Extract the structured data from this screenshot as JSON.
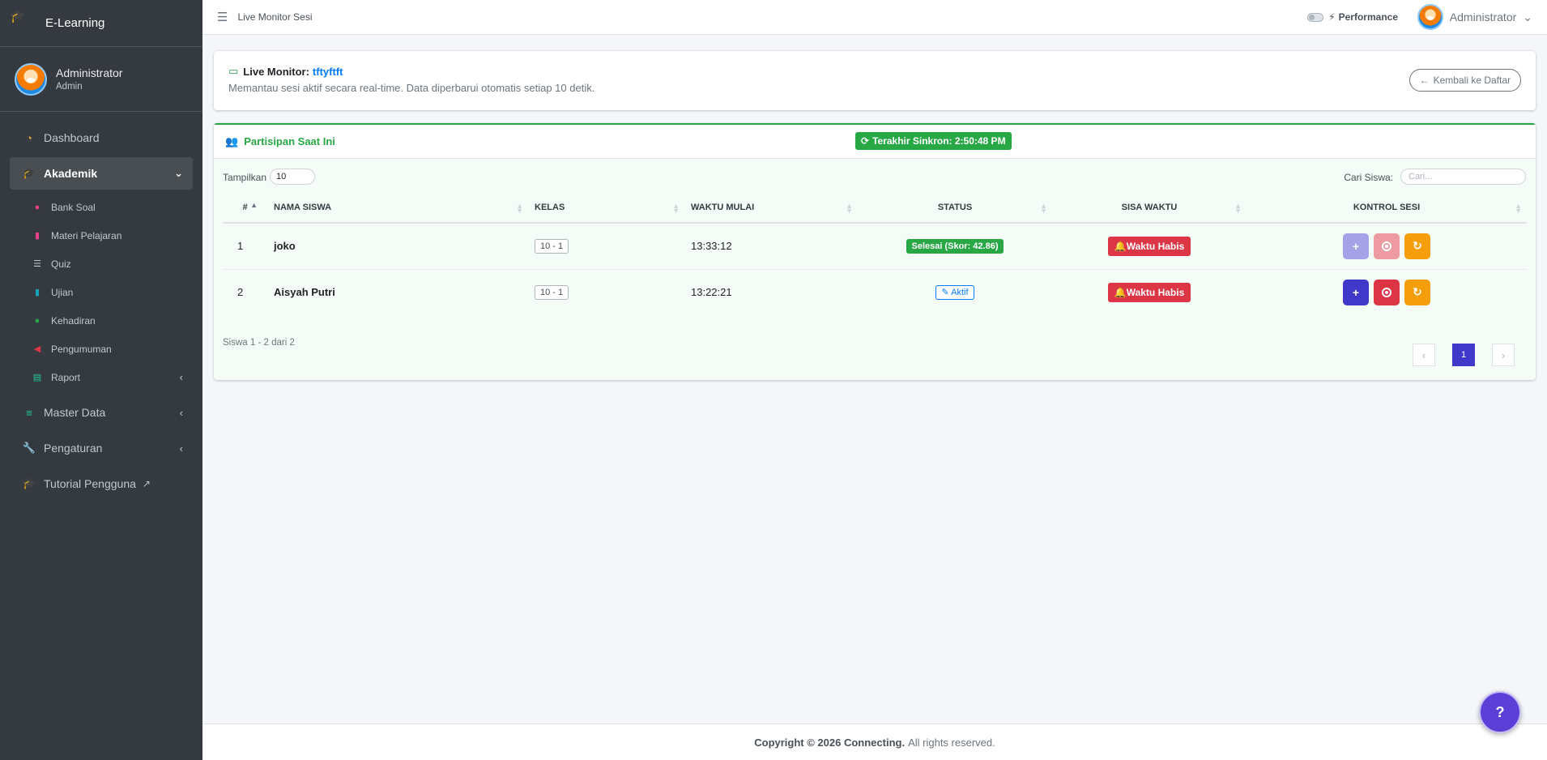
{
  "brand": {
    "name": "E-Learning",
    "logo_icon": "graduation-cap-icon"
  },
  "user": {
    "name": "Administrator",
    "role": "Admin"
  },
  "sidebar": {
    "items": [
      {
        "label": "Dashboard",
        "icon": "tachometer-icon",
        "icon_color": "#f0ad4e"
      },
      {
        "label": "Akademik",
        "icon": "graduation-cap-icon",
        "icon_color": "#17a2b8",
        "active": true
      },
      {
        "label": "Master Data",
        "icon": "database-icon",
        "icon_color": "#20c997"
      },
      {
        "label": "Pengaturan",
        "icon": "wrench-icon",
        "icon_color": "#fd7e14"
      },
      {
        "label": "Tutorial Pengguna",
        "icon": "graduation-cap-icon",
        "icon_color": "#fd7e14"
      }
    ],
    "sub_items": [
      {
        "label": "Bank Soal",
        "icon": "question-circle-icon",
        "icon_color": "#e83e8c"
      },
      {
        "label": "Materi Pelajaran",
        "icon": "file-icon",
        "icon_color": "#e83e8c"
      },
      {
        "label": "Quiz",
        "icon": "list-icon",
        "icon_color": "#c2c7d0"
      },
      {
        "label": "Ujian",
        "icon": "file-icon",
        "icon_color": "#17a2b8"
      },
      {
        "label": "Kehadiran",
        "icon": "map-marker-icon",
        "icon_color": "#28a745"
      },
      {
        "label": "Pengumuman",
        "icon": "bullhorn-icon",
        "icon_color": "#dc3545"
      },
      {
        "label": "Raport",
        "icon": "scroll-icon",
        "icon_color": "#20c997"
      }
    ]
  },
  "topbar": {
    "breadcrumb": "Live Monitor Sesi",
    "performance_label": "Performance",
    "user_name": "Administrator"
  },
  "header_card": {
    "title_prefix": "Live Monitor:",
    "session_name": "tftyftft",
    "description": "Memantau sesi aktif secara real-time. Data diperbarui otomatis setiap 10 detik.",
    "back_button": "Kembali ke Daftar"
  },
  "participants": {
    "title": "Partisipan Saat Ini",
    "sync_badge": "Terakhir Sinkron: 2:50:48 PM",
    "show_label": "Tampilkan",
    "show_value": "10",
    "search_label": "Cari Siswa:",
    "search_placeholder": "Cari...",
    "columns": [
      "#",
      "NAMA SISWA",
      "KELAS",
      "WAKTU MULAI",
      "STATUS",
      "SISA WAKTU",
      "KONTROL SESI"
    ],
    "rows": [
      {
        "num": "1",
        "name": "joko",
        "kelas": "10 - 1",
        "start": "13:33:12",
        "status": "Selesai (Skor: 42.86)",
        "status_type": "done",
        "remaining": "Waktu Habis"
      },
      {
        "num": "2",
        "name": "Aisyah Putri",
        "kelas": "10 - 1",
        "start": "13:22:21",
        "status": "Aktif",
        "status_type": "active",
        "remaining": "Waktu Habis"
      }
    ],
    "info": "Siswa 1 - 2 dari 2",
    "current_page": "1"
  },
  "footer": {
    "copyright": "Copyright © 2026 Connecting.",
    "rights": "All rights reserved."
  },
  "help_button": "?"
}
